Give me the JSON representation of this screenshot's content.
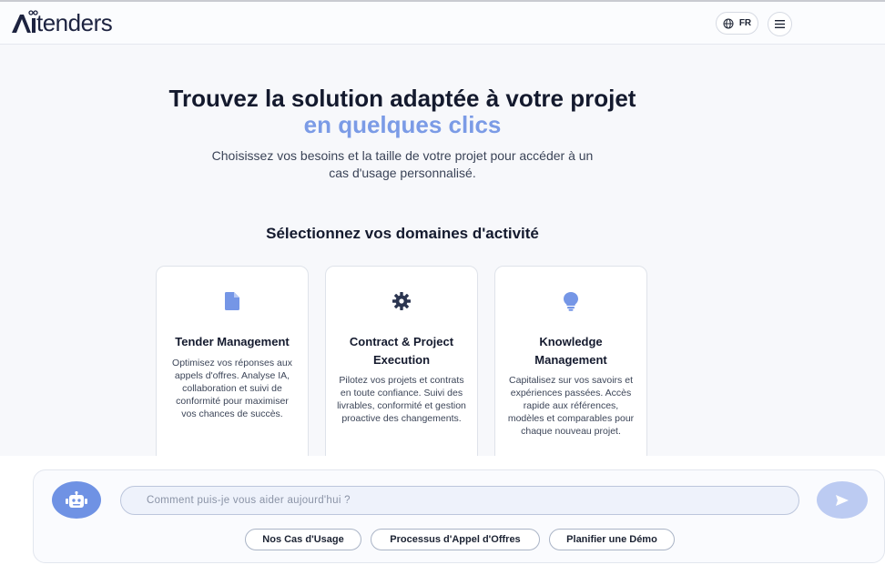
{
  "header": {
    "logo_text": "tenders",
    "language_label": "FR",
    "icons": {
      "language": "globe-icon",
      "menu": "hamburger-icon"
    }
  },
  "hero": {
    "title": "Trouvez la solution adaptée à votre projet",
    "subtitle": "en quelques clics",
    "description": "Choisissez vos besoins et la taille de votre projet pour accéder à un cas d'usage personnalisé."
  },
  "domains": {
    "section_title": "Sélectionnez vos domaines d'activité",
    "cards": [
      {
        "title": "Tender Management",
        "description": "Optimisez vos réponses aux appels d'offres. Analyse IA, collaboration et suivi de conformité pour maximiser vos chances de succès.",
        "icon": "document-icon"
      },
      {
        "title": "Contract & Project Execution",
        "description": "Pilotez vos projets et contrats en toute confiance. Suivi des livrables, conformité et gestion proactive des changements.",
        "icon": "gear-icon"
      },
      {
        "title": "Knowledge Management",
        "description": "Capitalisez sur vos savoirs et expériences passées. Accès rapide aux références, modèles et comparables pour chaque nouveau projet.",
        "icon": "lightbulb-icon"
      }
    ]
  },
  "chat": {
    "placeholder": "Comment puis-je vous aider aujourd'hui ?",
    "value": "",
    "bot_icon": "robot-icon",
    "send_icon": "send-icon",
    "suggestions": [
      "Nos Cas d'Usage",
      "Processus d'Appel d'Offres",
      "Planifier une Démo"
    ]
  },
  "colors": {
    "accent": "#7b9be6",
    "bot_avatar": "#6f92e4",
    "send_button": "#bccbf2",
    "title": "#141a2e",
    "icon": "#6f8fe4"
  }
}
